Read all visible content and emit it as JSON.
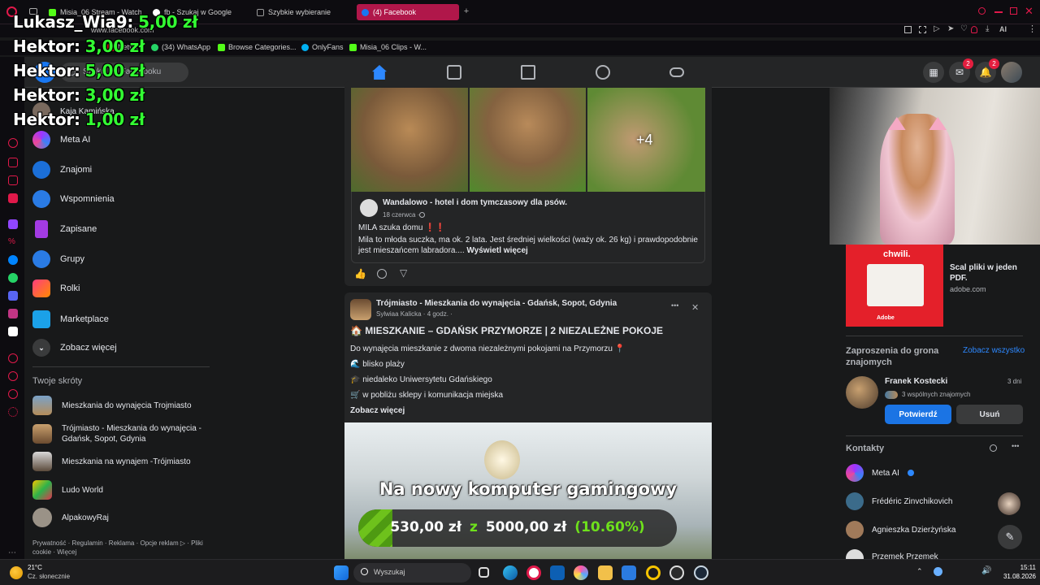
{
  "browser": {
    "tabs": [
      {
        "label": "Misia_06 Stream - Watch i",
        "color": "#53fc18"
      },
      {
        "label": "fb - Szukaj w Google",
        "color": "#ffffff"
      },
      {
        "label": "Szybkie wybieranie",
        "color": "#9a9a9a"
      },
      {
        "label": "(4) Facebook",
        "color": "#1877f2"
      }
    ],
    "address": "www.facebook.com",
    "bookmarks": [
      "Netflix",
      "(34) WhatsApp",
      "Browse Categories...",
      "OnlyFans",
      "Misia_06 Clips - W..."
    ],
    "extensions_ai": "AI"
  },
  "overlay": {
    "donations": [
      {
        "name": "Lukasz_Wia9:",
        "amount": "5,00 zł"
      },
      {
        "name": "Hektor:",
        "amount": "3,00 zł"
      },
      {
        "name": "Hektor:",
        "amount": "5,00 zł"
      },
      {
        "name": "Hektor:",
        "amount": "3,00 zł"
      },
      {
        "name": "Hektor:",
        "amount": "1,00 zł"
      }
    ],
    "goal": {
      "title": "Na nowy komputer gamingowy",
      "current": "530,00 zł",
      "sep": "z",
      "target": "5000,00 zł",
      "percent_label": "(10.60%)",
      "progress": 0.106
    }
  },
  "fb": {
    "search_placeholder": "Szukaj na Facebooku",
    "messenger_badge": "2",
    "notif_badge": "2",
    "sidebar": {
      "profile": "Kaja Kamińska",
      "items": [
        "Meta AI",
        "Znajomi",
        "Wspomnienia",
        "Zapisane",
        "Grupy",
        "Rolki",
        "Marketplace",
        "Zobacz więcej"
      ],
      "shortcuts_title": "Twoje skróty",
      "shortcuts": [
        "Mieszkania do wynajęcia Trojmiasto",
        "Trójmiasto - Mieszkania do wynajęcia - Gdańsk, Sopot, Gdynia",
        "Mieszkania na wynajem -Trójmiasto",
        "Ludo World",
        "AlpakowyRaj"
      ],
      "footer": "Prywatność · Regulamin · Reklama · Opcje reklam ▷ · Pliki cookie · Więcej"
    },
    "post1": {
      "more_photos": "+4",
      "page_name": "Wandalowo - hotel i dom tymczasowy dla psów.",
      "date": "18 czerwca · ",
      "line1": "MILA szuka domu ❗❗",
      "line2": "Mila to młoda suczka, ma ok. 2 lata. Jest średniej wielkości (waży ok. 26 kg) i prawdopodobnie jest mieszańcem labradora....",
      "see_more": "Wyświetl więcej"
    },
    "post2": {
      "group": "Trójmiasto - Mieszkania do wynajęcia - Gdańsk, Sopot, Gdynia",
      "author": "Sylwiaa Kalicka",
      "time": " · 4 godz. · ",
      "title": "🏠 MIESZKANIE – GDAŃSK PRZYMORZE | 2 NIEZALEŻNE POKOJE",
      "intro": "Do wynajęcia mieszkanie z dwoma niezależnymi pokojami na Przymorzu 📍",
      "bullets": [
        "🌊 blisko plaży",
        "🎓 niedaleko Uniwersytetu Gdańskiego",
        "🛒 w pobliżu sklepy i komunikacja miejska"
      ],
      "see_more": "Zobacz więcej",
      "more_icon": "•••",
      "close_icon": "✕"
    },
    "right": {
      "ad_text": "Scal pliki w jeden PDF.",
      "ad_domain": "adobe.com",
      "ad_image_text": "chwili.",
      "ad_brand": "Adobe",
      "invites_title": "Zaproszenia do grona znajomych",
      "see_all": "Zobacz wszystko",
      "friend_name": "Franek Kostecki",
      "friend_time": "3 dni",
      "mutual": "3 wspólnych znajomych",
      "confirm": "Potwierdź",
      "remove": "Usuń",
      "contacts_title": "Kontakty",
      "contacts": [
        "Meta AI",
        "Frédéric Zinvchikovich",
        "Agnieszka Dzierżyńska",
        "Przemek Przemek"
      ]
    }
  },
  "taskbar": {
    "weather_temp": "21°C",
    "weather_desc": "Cz. słonecznie",
    "search": "Wyszukaj",
    "time": "15:11",
    "date": "31.08.2026"
  }
}
